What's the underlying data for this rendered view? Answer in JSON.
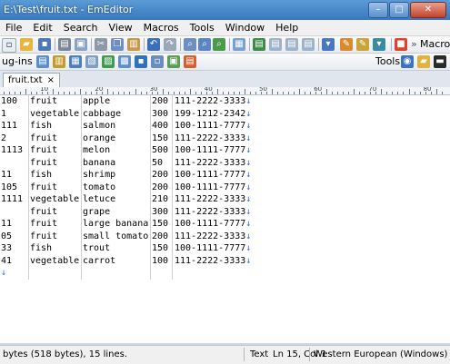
{
  "window": {
    "title": "E:\\Test\\fruit.txt - EmEditor",
    "buttons": {
      "minimize": "–",
      "maximize": "□",
      "close": "✕"
    }
  },
  "menu": [
    "File",
    "Edit",
    "Search",
    "View",
    "Macros",
    "Tools",
    "Window",
    "Help"
  ],
  "toolbar": {
    "macros_label": "Macros",
    "overflow_label": "»",
    "plugins_label": "ug-ins",
    "tools_label": "Tools"
  },
  "tab": {
    "label": "fruit.txt",
    "close": "×"
  },
  "ruler_numbers": [
    "10",
    "20",
    "30",
    "40",
    "50",
    "60",
    "70",
    "80"
  ],
  "rows": [
    [
      "100",
      "fruit",
      "apple",
      "200",
      "111-2222-3333"
    ],
    [
      "1",
      "vegetable",
      "cabbage",
      "300",
      "199-1212-2342"
    ],
    [
      "111",
      "fish",
      "salmon",
      "400",
      "100-1111-7777"
    ],
    [
      "2",
      "fruit",
      "orange",
      "150",
      "111-2222-3333"
    ],
    [
      "1113",
      "fruit",
      "melon",
      "500",
      "100-1111-7777"
    ],
    [
      "",
      "fruit",
      "banana",
      "50",
      "111-2222-3333"
    ],
    [
      "11",
      "fish",
      "shrimp",
      "200",
      "100-1111-7777"
    ],
    [
      "105",
      "fruit",
      "tomato",
      "200",
      "100-1111-7777"
    ],
    [
      "1111",
      "vegetable",
      "letuce",
      "210",
      "111-2222-3333"
    ],
    [
      "",
      "fruit",
      "grape",
      "300",
      "111-2222-3333"
    ],
    [
      "11",
      "fruit",
      "large banana",
      "150",
      "100-1111-7777"
    ],
    [
      "05",
      "fruit",
      "small tomato",
      "200",
      "111-2222-3333"
    ],
    [
      "33",
      "fish",
      "trout",
      "150",
      "100-1111-7777"
    ],
    [
      "41",
      "vegetable",
      "carrot",
      "100",
      "111-2222-3333"
    ]
  ],
  "line_end_mark": "↓",
  "eof_mark": "↓",
  "status": {
    "file_info": "bytes (518 bytes), 15 lines.",
    "mode": "Text",
    "position": "Ln 15, Col 1",
    "encoding": "Western European (Windows)"
  }
}
